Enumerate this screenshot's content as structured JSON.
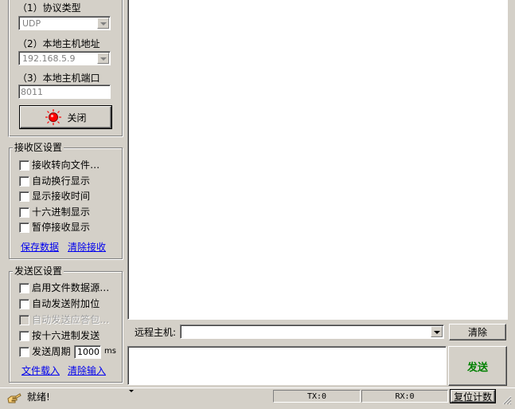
{
  "network": {
    "protocol_label": "（1）协议类型",
    "protocol_value": "UDP",
    "host_label": "（2）本地主机地址",
    "host_value": "192.168.5.9",
    "port_label": "（3）本地主机端口",
    "port_value": "8011",
    "close_button": "关闭",
    "status_light_color": "#ff0000"
  },
  "receive": {
    "title": "接收区设置",
    "options": [
      {
        "label": "接收转向文件...",
        "checked": false,
        "enabled": true
      },
      {
        "label": "自动换行显示",
        "checked": false,
        "enabled": true
      },
      {
        "label": "显示接收时间",
        "checked": false,
        "enabled": true
      },
      {
        "label": "十六进制显示",
        "checked": false,
        "enabled": true
      },
      {
        "label": "暂停接收显示",
        "checked": false,
        "enabled": true
      }
    ],
    "save_link": "保存数据",
    "clear_link": "清除接收"
  },
  "send": {
    "title": "发送区设置",
    "options": [
      {
        "label": "启用文件数据源...",
        "checked": false,
        "enabled": true
      },
      {
        "label": "自动发送附加位",
        "checked": false,
        "enabled": true
      },
      {
        "label": "自动发送应答包...",
        "checked": false,
        "enabled": false
      },
      {
        "label": "按十六进制发送",
        "checked": false,
        "enabled": true
      }
    ],
    "period_label": "发送周期",
    "period_value": "1000",
    "period_unit": "ms",
    "load_link": "文件载入",
    "clear_link": "清除输入"
  },
  "remote": {
    "label": "远程主机:",
    "value": "",
    "clear_button": "清除",
    "send_button": "发送",
    "send_color": "#008000"
  },
  "status": {
    "text": "就绪!",
    "tx": "TX:0",
    "rx": "RX:0",
    "reset_button": "复位计数"
  }
}
